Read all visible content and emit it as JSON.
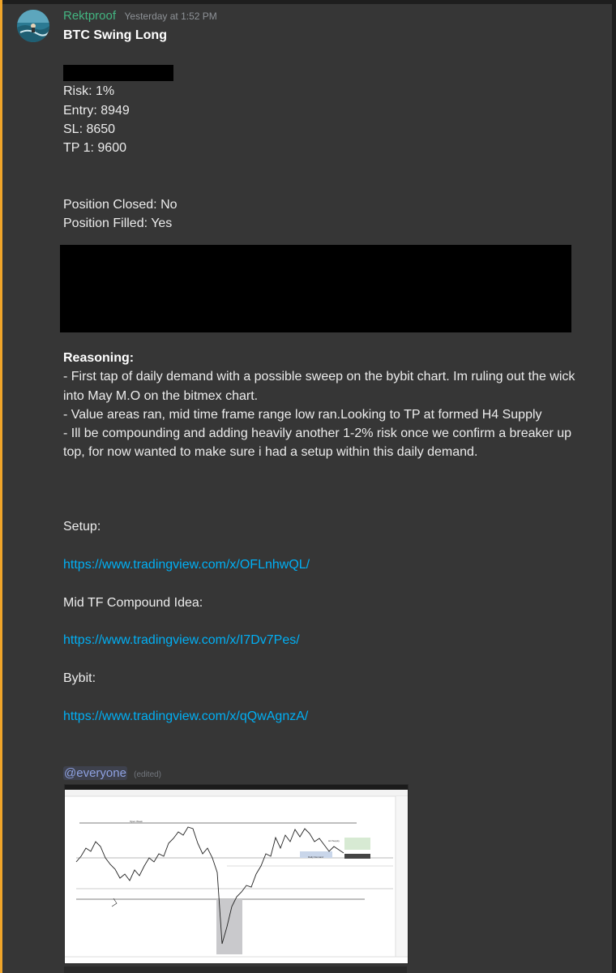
{
  "message": {
    "username": "Rektproof",
    "timestamp": "Yesterday at 1:52 PM",
    "title": "BTC Swing Long",
    "risk": "Risk: 1%",
    "entry": "Entry: 8949",
    "sl": "SL: 8650",
    "tp1": "TP 1: 9600",
    "position_closed": "Position Closed: No",
    "position_filled": "Position Filled: Yes",
    "reasoning_heading": "Reasoning:",
    "reasoning_1": "- First tap of daily demand with a possible sweep on the bybit chart. Im ruling out the wick into May M.O on the bitmex chart.",
    "reasoning_2": "- Value areas ran, mid time frame range low ran.Looking to TP at formed H4 Supply",
    "reasoning_3": "- Ill be compounding and adding heavily another 1-2% risk once we confirm a breaker up top, for now wanted to make sure i had a setup within this daily demand.",
    "setup_label": "Setup:",
    "setup_link": "https://www.tradingview.com/x/OFLnhwQL/",
    "mid_tf_label": "Mid TF Compound Idea:",
    "mid_tf_link": "https://www.tradingview.com/x/I7Dv7Pes/",
    "bybit_label": "Bybit:",
    "bybit_link": "https://www.tradingview.com/x/qQwAgnzA/",
    "mention": "@everyone",
    "edited": "(edited)"
  },
  "colors": {
    "accent": "#f0a52a",
    "username": "#43b581",
    "link": "#00aff4",
    "mention": "#8ea1e1",
    "background": "#363636"
  },
  "icons": {
    "avatar": "avatar-image",
    "attachment": "chart-screenshot-attachment"
  }
}
